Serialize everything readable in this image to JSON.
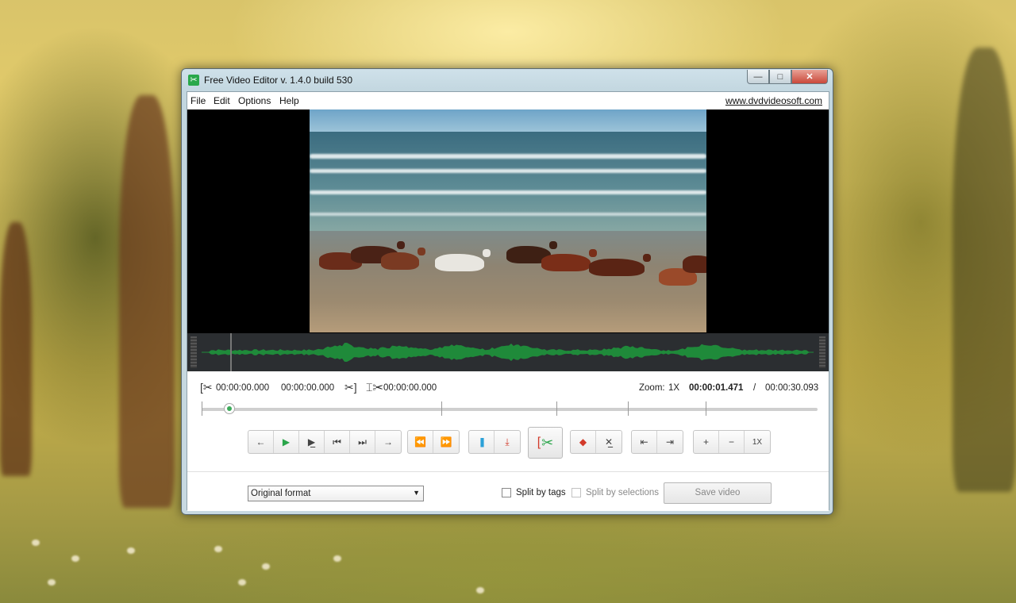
{
  "window": {
    "title": "Free Video Editor v. 1.4.0 build 530",
    "app_icon": "scissors-icon",
    "controls": {
      "minimize": "—",
      "maximize": "□",
      "close": "✕"
    }
  },
  "menubar": {
    "items": [
      "File",
      "Edit",
      "Options",
      "Help"
    ],
    "site_link": "www.dvdvideosoft.com"
  },
  "times": {
    "selection_start": "00:00:00.000",
    "selection_end": "00:00:00.000",
    "cut_time": "00:00:00.000",
    "zoom_label": "Zoom:",
    "zoom_value": "1X",
    "current_time": "00:00:01.471",
    "separator": "/",
    "total_time": "00:00:30.093"
  },
  "toolbar": {
    "zoom_reset": "1X"
  },
  "bottom": {
    "format_selected": "Original format",
    "split_by_tags": "Split by tags",
    "split_by_selections": "Split by selections",
    "save_video": "Save video"
  },
  "colors": {
    "accent_green": "#2aa54a",
    "accent_red": "#d23a2a",
    "waveform": "#1f8a3a"
  }
}
